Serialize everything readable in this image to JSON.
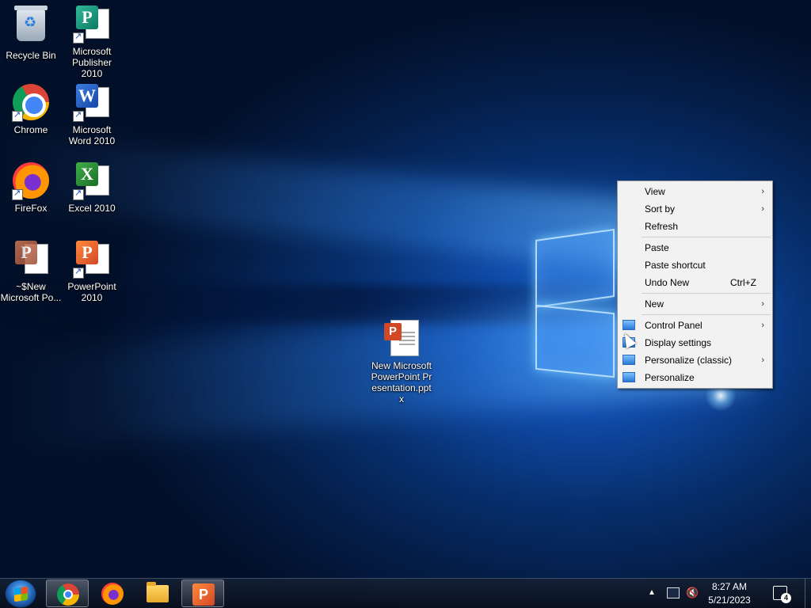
{
  "desktop_icons": [
    {
      "label": "Recycle Bin",
      "icon": "recycle-bin-icon"
    },
    {
      "label": "Microsoft Publisher 2010",
      "icon": "publisher-icon"
    },
    {
      "label": "Chrome",
      "icon": "chrome-icon"
    },
    {
      "label": "Microsoft Word 2010",
      "icon": "word-icon"
    },
    {
      "label": "FireFox",
      "icon": "firefox-icon"
    },
    {
      "label": "Excel 2010",
      "icon": "excel-icon"
    },
    {
      "label": "~$New Microsoft Po...",
      "icon": "powerpoint-temp-file-icon"
    },
    {
      "label": "PowerPoint 2010",
      "icon": "powerpoint-icon"
    },
    {
      "label": "New Microsoft PowerPoint Presentation.pptx",
      "icon": "pptx-file-icon"
    }
  ],
  "icon_letters": {
    "publisher": "P",
    "word": "W",
    "excel": "X",
    "powerpoint": "P"
  },
  "context_menu": {
    "view": "View",
    "sort_by": "Sort by",
    "refresh": "Refresh",
    "paste": "Paste",
    "paste_shortcut": "Paste shortcut",
    "undo_new": "Undo New",
    "undo_new_shortcut": "Ctrl+Z",
    "new": "New",
    "control_panel": "Control Panel",
    "display_settings": "Display settings",
    "personalize_classic": "Personalize (classic)",
    "personalize": "Personalize",
    "submenu_arrow": "›"
  },
  "taskbar": {
    "pinned": [
      "Chrome",
      "Firefox",
      "File Explorer",
      "PowerPoint"
    ],
    "tray_up_arrow": "▲",
    "volume_glyph": "🔇",
    "time": "8:27 AM",
    "date": "5/21/2023",
    "notification_count": "4"
  },
  "colors": {
    "menu_bg": "#f2f2f2",
    "taskbar_bg": "#0e1a2e",
    "desktop_blue": "#0f4aa8"
  }
}
